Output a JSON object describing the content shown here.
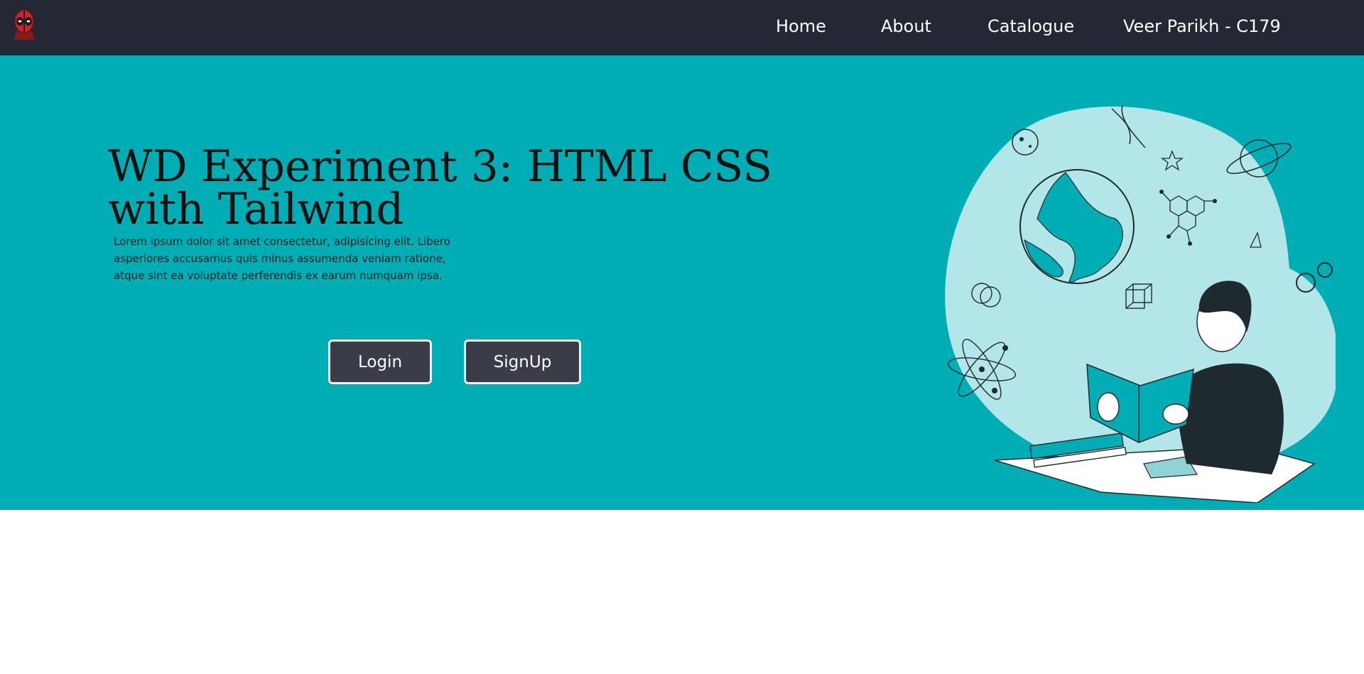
{
  "navbar": {
    "links": [
      {
        "label": "Home"
      },
      {
        "label": "About"
      },
      {
        "label": "Catalogue"
      },
      {
        "label": "Veer Parikh - C179"
      }
    ]
  },
  "hero": {
    "title": "WD Experiment 3: HTML CSS with Tailwind",
    "description": "Lorem ipsum dolor sit amet consectetur, adipisicing elit. Libero asperiores accusamus quis minus assumenda veniam ratione, atque sint ea voluptate perferendis ex earum numquam ipsa.",
    "login_label": "Login",
    "signup_label": "SignUp"
  },
  "colors": {
    "navbar_bg": "#232834",
    "hero_bg": "#00adb5",
    "button_bg": "#3a3d47",
    "illustration_bg": "#b2e6e8"
  }
}
